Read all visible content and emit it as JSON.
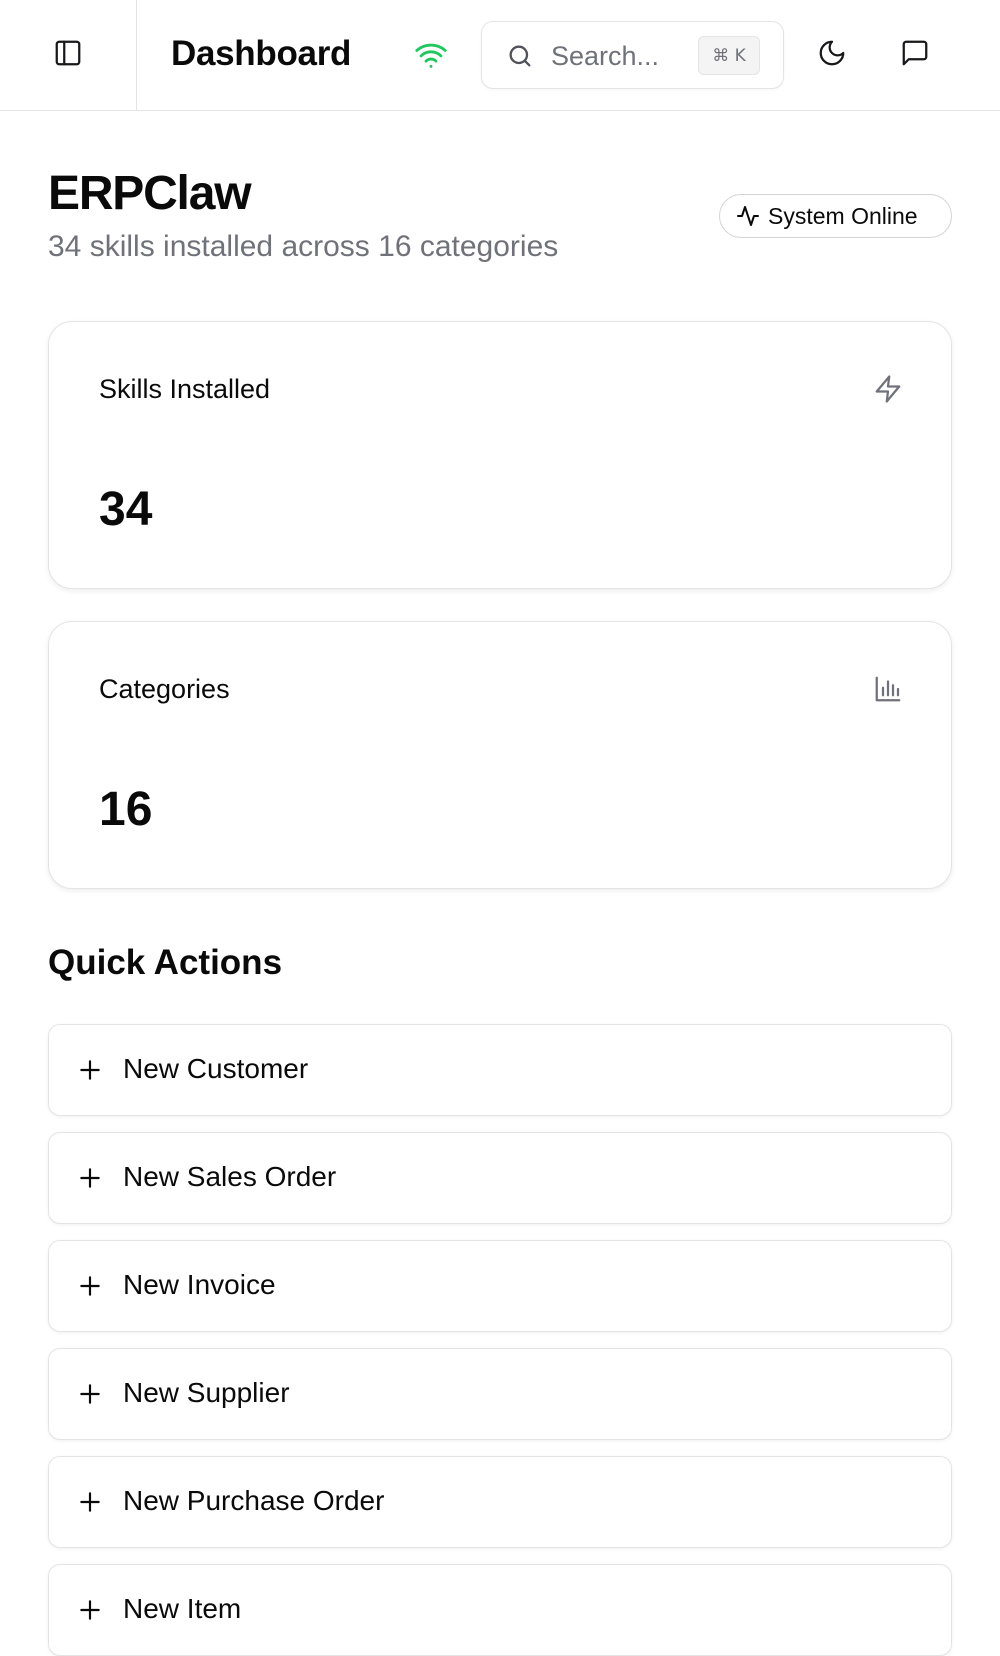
{
  "topbar": {
    "title": "Dashboard",
    "search_placeholder": "Search...",
    "search_shortcut": "⌘ K",
    "connection_color": "#22c55e"
  },
  "header": {
    "title": "ERPClaw",
    "subtitle": "34 skills installed across 16 categories",
    "status": "System Online"
  },
  "stats": [
    {
      "label": "Skills Installed",
      "value": "34",
      "icon": "zap-icon"
    },
    {
      "label": "Categories",
      "value": "16",
      "icon": "bar-chart-icon"
    }
  ],
  "quick_actions": {
    "title": "Quick Actions",
    "items": [
      {
        "label": "New Customer"
      },
      {
        "label": "New Sales Order"
      },
      {
        "label": "New Invoice"
      },
      {
        "label": "New Supplier"
      },
      {
        "label": "New Purchase Order"
      },
      {
        "label": "New Item"
      }
    ]
  }
}
